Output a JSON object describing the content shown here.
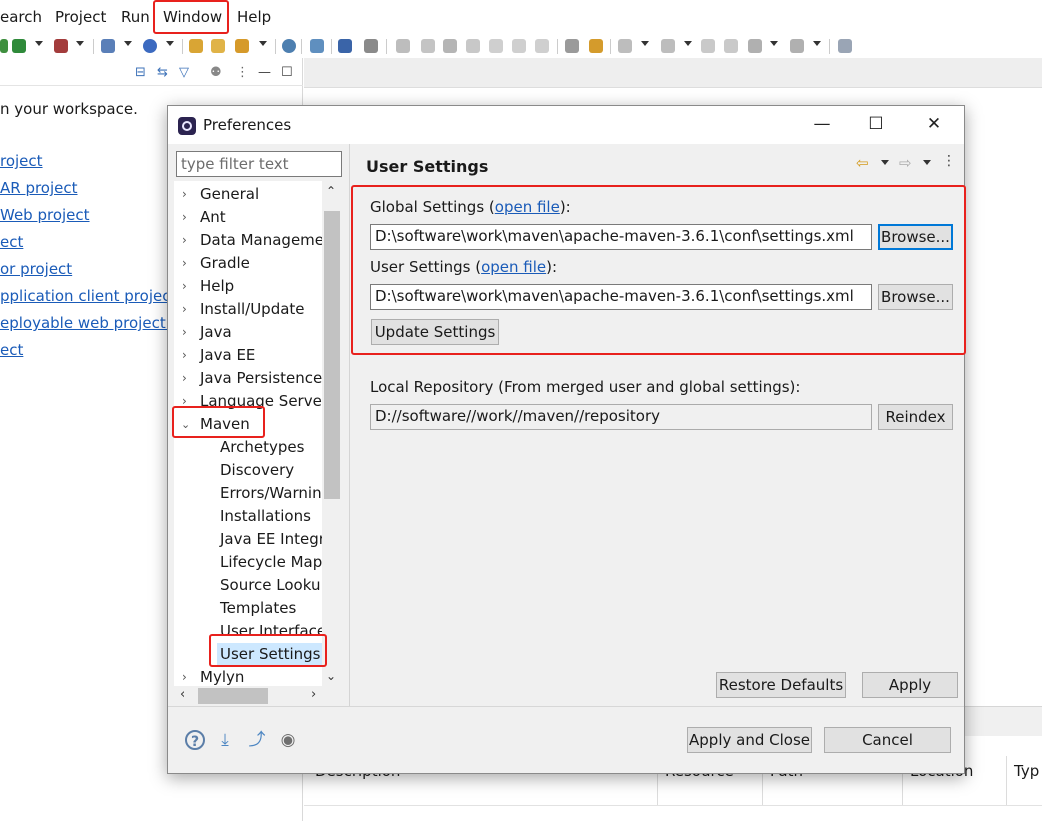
{
  "menubar": {
    "items": [
      "earch",
      "Project",
      "Run",
      "Window",
      "Help"
    ]
  },
  "left_view": {
    "workspace_text": "n your workspace.",
    "links": [
      "roject",
      "AR project",
      "Web project",
      "ect",
      "or project",
      "pplication client project",
      "eployable web project.",
      "ect"
    ]
  },
  "problems_view": {
    "columns": [
      "Description",
      "Resource",
      "Path",
      "Location",
      "Typ"
    ]
  },
  "dialog": {
    "title": "Preferences",
    "window_buttons": {
      "minimize": "—",
      "maximize": "☐",
      "close": "✕"
    },
    "filter_placeholder": "type filter text",
    "tree": {
      "top_items": [
        "General",
        "Ant",
        "Data Manageme",
        "Gradle",
        "Help",
        "Install/Update",
        "Java",
        "Java EE",
        "Java Persistence",
        "Language Server"
      ],
      "expanded": "Maven",
      "maven_children": [
        "Archetypes",
        "Discovery",
        "Errors/Warnin",
        "Installations",
        "Java EE Integra",
        "Lifecycle Map",
        "Source Looku",
        "Templates",
        "User Interface",
        "User Settings"
      ],
      "selected": "User Settings",
      "after": "Mylyn"
    },
    "page": {
      "title": "User Settings",
      "global_settings_label": "Global Settings (",
      "global_settings_link": "open file",
      "global_settings_suffix": "):",
      "global_settings_value": "D:\\software\\work\\maven\\apache-maven-3.6.1\\conf\\settings.xml",
      "browse_1": "Browse...",
      "user_settings_label": "User Settings (",
      "user_settings_link": "open file",
      "user_settings_suffix": "):",
      "user_settings_value": "D:\\software\\work\\maven\\apache-maven-3.6.1\\conf\\settings.xml",
      "browse_2": "Browse...",
      "update_settings": "Update Settings",
      "local_repo_label": "Local Repository (From merged user and global settings):",
      "local_repo_value": "D://software//work//maven//repository",
      "reindex": "Reindex",
      "restore_defaults": "Restore Defaults",
      "apply": "Apply"
    },
    "footer": {
      "apply_and_close": "Apply and Close",
      "cancel": "Cancel"
    }
  },
  "colors": {
    "highlight": "#e8211d",
    "link": "#1a5bb8",
    "selection": "#cde8ff",
    "dialog_bg": "#f0f0f0"
  }
}
